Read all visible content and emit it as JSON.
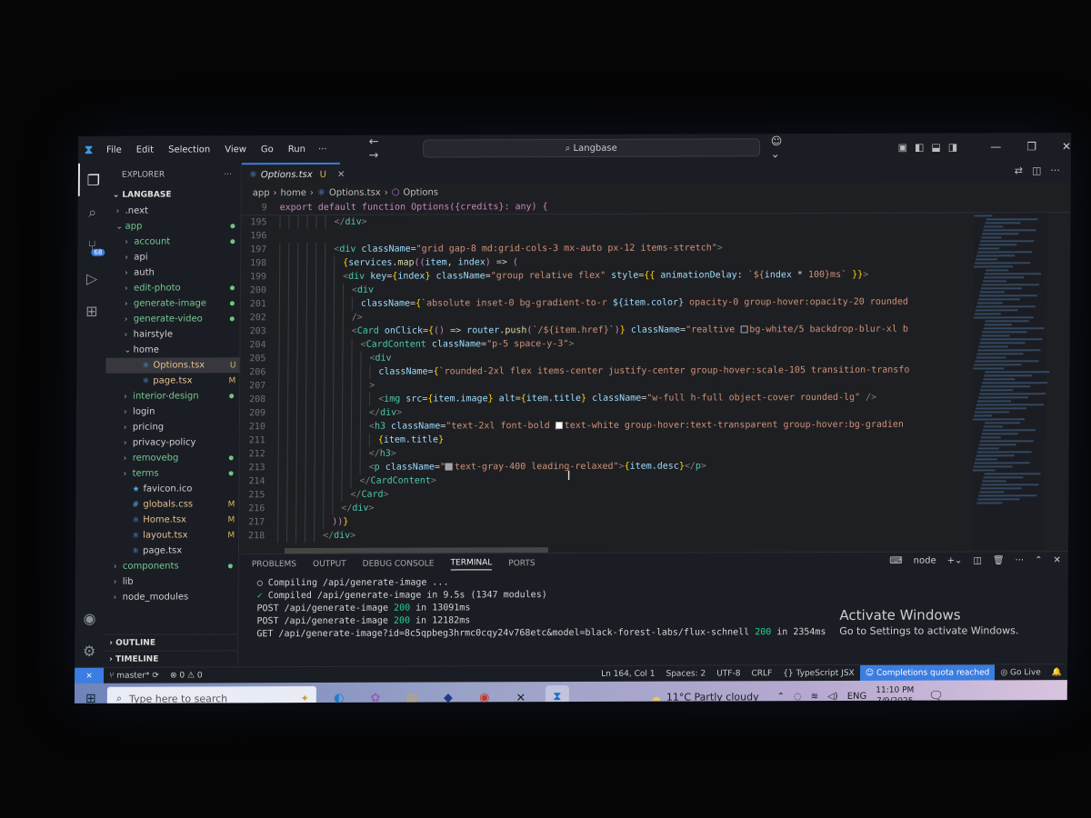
{
  "window": {
    "menu": [
      "File",
      "Edit",
      "Selection",
      "View",
      "Go",
      "Run"
    ],
    "more": "···",
    "search": "Langbase"
  },
  "explorer": {
    "title": "EXPLORER",
    "workspace": "LANGBASE",
    "outline": "OUTLINE",
    "timeline": "TIMELINE",
    "scm_badge": "68"
  },
  "tree": [
    {
      "label": ".next",
      "depth": 1,
      "folder": true,
      "open": false,
      "status": ""
    },
    {
      "label": "app",
      "depth": 1,
      "folder": true,
      "open": true,
      "status": "dot"
    },
    {
      "label": "account",
      "depth": 2,
      "folder": true,
      "open": false,
      "status": "dot"
    },
    {
      "label": "api",
      "depth": 2,
      "folder": true,
      "open": false,
      "status": ""
    },
    {
      "label": "auth",
      "depth": 2,
      "folder": true,
      "open": false,
      "status": ""
    },
    {
      "label": "edit-photo",
      "depth": 2,
      "folder": true,
      "open": false,
      "status": "dot"
    },
    {
      "label": "generate-image",
      "depth": 2,
      "folder": true,
      "open": false,
      "status": "dot"
    },
    {
      "label": "generate-video",
      "depth": 2,
      "folder": true,
      "open": false,
      "status": "dot"
    },
    {
      "label": "hairstyle",
      "depth": 2,
      "folder": true,
      "open": false,
      "status": ""
    },
    {
      "label": "home",
      "depth": 2,
      "folder": true,
      "open": true,
      "status": ""
    },
    {
      "label": "Options.tsx",
      "depth": 3,
      "folder": false,
      "open": false,
      "status": "U",
      "selected": true
    },
    {
      "label": "page.tsx",
      "depth": 3,
      "folder": false,
      "open": false,
      "status": "M"
    },
    {
      "label": "interior-design",
      "depth": 2,
      "folder": true,
      "open": false,
      "status": "dot"
    },
    {
      "label": "login",
      "depth": 2,
      "folder": true,
      "open": false,
      "status": ""
    },
    {
      "label": "pricing",
      "depth": 2,
      "folder": true,
      "open": false,
      "status": ""
    },
    {
      "label": "privacy-policy",
      "depth": 2,
      "folder": true,
      "open": false,
      "status": ""
    },
    {
      "label": "removebg",
      "depth": 2,
      "folder": true,
      "open": false,
      "status": "dot"
    },
    {
      "label": "terms",
      "depth": 2,
      "folder": true,
      "open": false,
      "status": "dot"
    },
    {
      "label": "favicon.ico",
      "depth": 2,
      "folder": false,
      "open": false,
      "status": ""
    },
    {
      "label": "globals.css",
      "depth": 2,
      "folder": false,
      "open": false,
      "status": "M"
    },
    {
      "label": "Home.tsx",
      "depth": 2,
      "folder": false,
      "open": false,
      "status": "M"
    },
    {
      "label": "layout.tsx",
      "depth": 2,
      "folder": false,
      "open": false,
      "status": "M"
    },
    {
      "label": "page.tsx",
      "depth": 2,
      "folder": false,
      "open": false,
      "status": ""
    },
    {
      "label": "components",
      "depth": 1,
      "folder": true,
      "open": false,
      "status": "dot"
    },
    {
      "label": "lib",
      "depth": 1,
      "folder": true,
      "open": false,
      "status": ""
    },
    {
      "label": "node_modules",
      "depth": 1,
      "folder": true,
      "open": false,
      "status": ""
    }
  ],
  "editor": {
    "tab_label": "Options.tsx",
    "tab_status": "U",
    "breadcrumb": [
      "app",
      "home",
      "Options.tsx",
      "Options"
    ],
    "sticky_line_no": "9",
    "sticky_text": "export default function Options({credits}: any) {",
    "lines": [
      {
        "n": "195",
        "indent": 6,
        "html": "<span class='tok-p'>&lt;/</span><span class='tok-tag'>div</span><span class='tok-p'>&gt;</span>"
      },
      {
        "n": "196",
        "indent": 0,
        "html": ""
      },
      {
        "n": "197",
        "indent": 6,
        "html": "<span class='tok-p'>&lt;</span><span class='tok-tag'>div</span> <span class='tok-attr'>className</span>=<span class='tok-str'>\"grid gap-8 md:grid-cols-3 mx-auto px-12 items-stretch\"</span><span class='tok-p'>&gt;</span>"
      },
      {
        "n": "198",
        "indent": 7,
        "html": "<span class='tok-br'>{</span><span class='tok-var'>services</span>.<span class='tok-fn'>map</span><span class='tok-kw'>((</span><span class='tok-var'>item</span>, <span class='tok-var'>index</span><span class='tok-kw'>)</span> =&gt; <span class='tok-kw'>(</span>"
      },
      {
        "n": "199",
        "indent": 7,
        "html": "<span class='tok-p'>&lt;</span><span class='tok-tag'>div</span> <span class='tok-attr'>key</span>=<span class='tok-br'>{</span><span class='tok-var'>index</span><span class='tok-br'>}</span> <span class='tok-attr'>className</span>=<span class='tok-str'>\"group relative flex\"</span> <span class='tok-attr'>style</span>=<span class='tok-br'>{{</span> <span class='tok-attr'>animationDelay</span>: <span class='tok-str'>`${</span><span class='tok-var'>index</span> * <span class='tok-str'>100}ms`</span> <span class='tok-br'>}}</span><span class='tok-p'>&gt;</span>"
      },
      {
        "n": "200",
        "indent": 8,
        "html": "<span class='tok-p'>&lt;</span><span class='tok-tag'>div</span>"
      },
      {
        "n": "201",
        "indent": 9,
        "html": "<span class='tok-attr'>className</span>=<span class='tok-br'>{</span><span class='tok-str'>`absolute inset-0 bg-gradient-to-r </span><span class='tok-var'>${item.color}</span><span class='tok-str'> opacity-0 group-hover:opacity-20 rounded</span>"
      },
      {
        "n": "202",
        "indent": 8,
        "html": "<span class='tok-p'>/&gt;</span>"
      },
      {
        "n": "203",
        "indent": 8,
        "html": "<span class='tok-p'>&lt;</span><span class='tok-tag'>Card</span> <span class='tok-attr'>onClick</span>=<span class='tok-br'>{</span><span class='tok-kw'>()</span> =&gt; <span class='tok-var'>router</span>.<span class='tok-fn'>push</span><span class='tok-kw'>(</span><span class='tok-str'>`/${item.href}`</span><span class='tok-kw'>)</span><span class='tok-br'>}</span> <span class='tok-attr'>className</span>=<span class='tok-str'>\"realtive <i class='swatch'></i>bg-white/5 backdrop-blur-xl b</span>"
      },
      {
        "n": "204",
        "indent": 9,
        "html": "<span class='tok-p'>&lt;</span><span class='tok-tag'>CardContent</span> <span class='tok-attr'>className</span>=<span class='tok-str'>\"p-5 space-y-3\"</span><span class='tok-p'>&gt;</span>"
      },
      {
        "n": "205",
        "indent": 10,
        "html": "<span class='tok-p'>&lt;</span><span class='tok-tag'>div</span>"
      },
      {
        "n": "206",
        "indent": 11,
        "html": "<span class='tok-attr'>className</span>=<span class='tok-br'>{</span><span class='tok-str'>`rounded-2xl flex items-center justify-center group-hover:scale-105 transition-transfo</span>"
      },
      {
        "n": "207",
        "indent": 10,
        "html": "<span class='tok-p'>&gt;</span>"
      },
      {
        "n": "208",
        "indent": 11,
        "html": "<span class='tok-p'>&lt;</span><span class='tok-tag'>img</span> <span class='tok-attr'>src</span>=<span class='tok-br'>{</span><span class='tok-var'>item.image</span><span class='tok-br'>}</span> <span class='tok-attr'>alt</span>=<span class='tok-br'>{</span><span class='tok-var'>item.title</span><span class='tok-br'>}</span> <span class='tok-attr'>className</span>=<span class='tok-str'>\"w-full h-full object-cover rounded-lg\"</span> <span class='tok-p'>/&gt;</span>"
      },
      {
        "n": "209",
        "indent": 10,
        "html": "<span class='tok-p'>&lt;/</span><span class='tok-tag'>div</span><span class='tok-p'>&gt;</span>"
      },
      {
        "n": "210",
        "indent": 10,
        "html": "<span class='tok-p'>&lt;</span><span class='tok-tag'>h3</span> <span class='tok-attr'>className</span>=<span class='tok-str'>\"text-2xl font-bold <i class='swatch white'></i>text-white group-hover:text-transparent group-hover:bg-gradien</span>"
      },
      {
        "n": "211",
        "indent": 11,
        "html": "<span class='tok-br'>{</span><span class='tok-var'>item.title</span><span class='tok-br'>}</span>"
      },
      {
        "n": "212",
        "indent": 10,
        "html": "<span class='tok-p'>&lt;/</span><span class='tok-tag'>h3</span><span class='tok-p'>&gt;</span>"
      },
      {
        "n": "213",
        "indent": 10,
        "html": "<span class='tok-p'>&lt;</span><span class='tok-tag'>p</span> <span class='tok-attr'>className</span>=<span class='tok-str'>\"<i class='swatch gray'></i>text-gray-400 leading-relaxed\"</span><span class='tok-p'>&gt;</span><span class='tok-br'>{</span><span class='tok-var'>item.desc</span><span class='tok-br'>}</span><span class='tok-p'>&lt;/</span><span class='tok-tag'>p</span><span class='tok-p'>&gt;</span>"
      },
      {
        "n": "214",
        "indent": 9,
        "html": "<span class='tok-p'>&lt;/</span><span class='tok-tag'>CardContent</span><span class='tok-p'>&gt;</span>"
      },
      {
        "n": "215",
        "indent": 8,
        "html": "<span class='tok-p'>&lt;/</span><span class='tok-tag'>Card</span><span class='tok-p'>&gt;</span>"
      },
      {
        "n": "216",
        "indent": 7,
        "html": "<span class='tok-p'>&lt;/</span><span class='tok-tag'>div</span><span class='tok-p'>&gt;</span>"
      },
      {
        "n": "217",
        "indent": 6,
        "html": "<span class='tok-kw'>))</span><span class='tok-br'>}</span>"
      },
      {
        "n": "218",
        "indent": 5,
        "html": "<span class='tok-p'>&lt;/</span><span class='tok-tag'>div</span><span class='tok-p'>&gt;</span>"
      }
    ]
  },
  "panel": {
    "tabs": [
      "PROBLEMS",
      "OUTPUT",
      "DEBUG CONSOLE",
      "TERMINAL",
      "PORTS"
    ],
    "active_tab": "TERMINAL",
    "shell": "node",
    "terminal": [
      {
        "prefix": "○",
        "text": "Compiling /api/generate-image ..."
      },
      {
        "prefix": "✓",
        "text": "Compiled /api/generate-image in 9.5s (1347 modules)"
      },
      {
        "prefix": "",
        "text": "POST /api/generate-image 200 in 13091ms"
      },
      {
        "prefix": "",
        "text": "POST /api/generate-image 200 in 12182ms"
      },
      {
        "prefix": "",
        "text": "GET /api/generate-image?id=8c5qpbeg3hrmc0cqy24v768etc&model=black-forest-labs/flux-schnell 200 in 2354ms"
      }
    ],
    "activate_title": "Activate Windows",
    "activate_sub": "Go to Settings to activate Windows."
  },
  "status": {
    "branch": "master*",
    "problems": "⊗ 0 ⚠ 0",
    "position": "Ln 164, Col 1",
    "spaces": "Spaces: 2",
    "encoding": "UTF-8",
    "eol": "CRLF",
    "language": "TypeScript JSX",
    "quota": "Completions quota reached",
    "golive": "Go Live"
  },
  "taskbar": {
    "search_placeholder": "Type here to search",
    "weather": "11°C  Partly cloudy",
    "lang": "ENG",
    "time": "11:10 PM",
    "date": "7/9/2025"
  }
}
